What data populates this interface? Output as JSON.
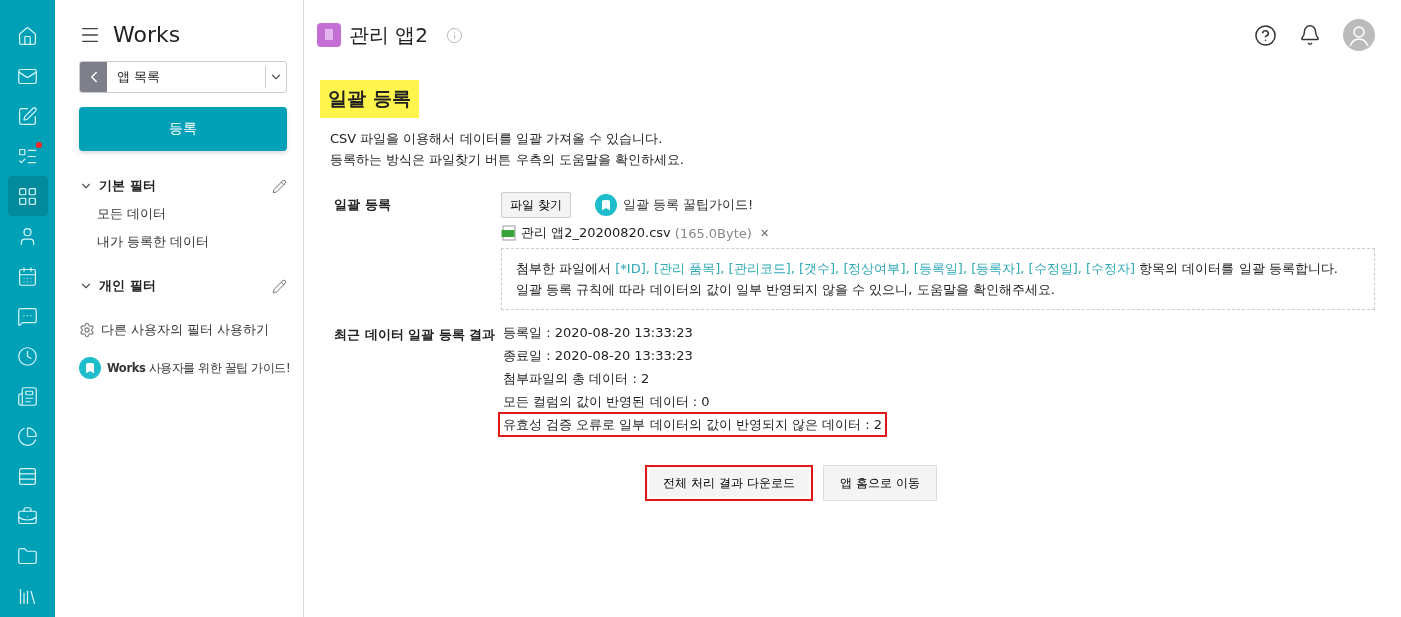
{
  "rail": [
    {
      "kind": "home",
      "selected": false,
      "badge": false
    },
    {
      "kind": "mail",
      "selected": false,
      "badge": false
    },
    {
      "kind": "note",
      "selected": false,
      "badge": false
    },
    {
      "kind": "list",
      "selected": false,
      "badge": true
    },
    {
      "kind": "apps",
      "selected": true,
      "badge": false
    },
    {
      "kind": "contact",
      "selected": false,
      "badge": false
    },
    {
      "kind": "calendar",
      "selected": false,
      "badge": false
    },
    {
      "kind": "chat",
      "selected": false,
      "badge": false
    },
    {
      "kind": "clock",
      "selected": false,
      "badge": false
    },
    {
      "kind": "board",
      "selected": false,
      "badge": false
    },
    {
      "kind": "chart",
      "selected": false,
      "badge": false
    },
    {
      "kind": "rows",
      "selected": false,
      "badge": false
    },
    {
      "kind": "briefcase",
      "selected": false,
      "badge": false
    },
    {
      "kind": "folder",
      "selected": false,
      "badge": false
    },
    {
      "kind": "library",
      "selected": false,
      "badge": false
    }
  ],
  "sidebar": {
    "title": "Works",
    "app_select": "앱 목록",
    "register_button": "등록",
    "sections": [
      {
        "title": "기본 필터",
        "expanded": true,
        "items": [
          "모든 데이터",
          "내가 등록한 데이터"
        ]
      },
      {
        "title": "개인 필터",
        "expanded": true
      }
    ],
    "other_filter_link": "다른 사용자의 필터 사용하기",
    "guide_link": "**Works** 사용자를 위한 꿀팁 가이드!"
  },
  "header": {
    "app_title": "관리 앱2"
  },
  "page": {
    "heading": "일괄 등록",
    "intro": [
      "CSV 파일을 이용해서 데이터를 일괄 가져올 수 있습니다.",
      "등록하는 방식은 파일찾기 버튼 우측의 도움말을 확인하세요."
    ],
    "upload": {
      "label": "일괄 등록",
      "browse_button": "파일 찾기",
      "guide_link": "일괄 등록 꿀팁가이드!",
      "file_name": "관리 앱2_20200820.csv",
      "file_size": "(165.0Byte)",
      "remove": "✕",
      "notice": [
        {
          "before": "첨부한 파일에서 ",
          "highlight": "[*ID], [관리 품목], [관리코드], [갯수], [정상여부], [등록일], [등록자], [수정일], [수정자]",
          "after": " 항목의 데이터를 일괄 등록합니다."
        },
        {
          "before": "일괄 등록 규칙에 따라 데이터의 값이 일부 반영되지 않을 수 있으니, 도움말을 확인해주세요."
        }
      ]
    },
    "results": {
      "label": "최근 데이터 일괄 등록 결과",
      "lines": [
        {
          "text": "등록일 : 2020-08-20 13:33:23",
          "highlighted": false
        },
        {
          "text": "종료일 : 2020-08-20 13:33:23",
          "highlighted": false
        },
        {
          "text": "첨부파일의 총 데이터 : 2",
          "highlighted": false
        },
        {
          "text": "모든 컬럼의 값이 반영된 데이터 : 0",
          "highlighted": false
        },
        {
          "text": "유효성 검증 오류로 일부 데이터의 값이 반영되지 않은 데이터 : 2",
          "highlighted": true
        }
      ]
    },
    "actions": [
      {
        "label": "전체 처리 결과 다운로드",
        "highlighted": true
      },
      {
        "label": "앱 홈으로 이동",
        "highlighted": false
      }
    ]
  }
}
